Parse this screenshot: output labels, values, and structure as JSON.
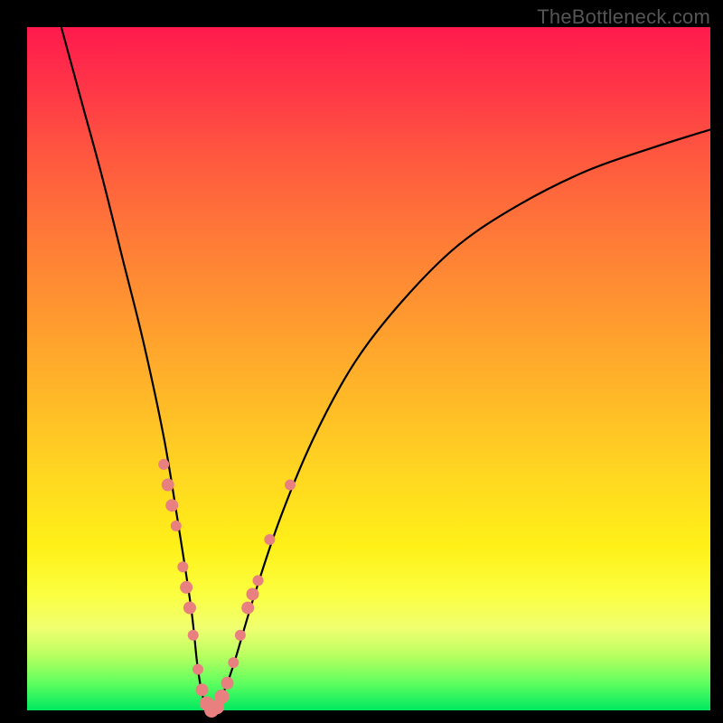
{
  "watermark": "TheBottleneck.com",
  "chart_data": {
    "type": "line",
    "title": "",
    "xlabel": "",
    "ylabel": "",
    "xlim": [
      0,
      100
    ],
    "ylim": [
      0,
      100
    ],
    "series": [
      {
        "name": "bottleneck-curve",
        "x": [
          5,
          8,
          11,
          14,
          17,
          20,
          22,
          24,
          25,
          26,
          27,
          28,
          30,
          33,
          37,
          42,
          48,
          55,
          63,
          72,
          82,
          92,
          100
        ],
        "y": [
          100,
          89,
          78,
          66,
          54,
          40,
          28,
          15,
          6,
          1,
          0,
          1,
          6,
          16,
          28,
          40,
          51,
          60,
          68,
          74,
          79,
          82.5,
          85
        ]
      }
    ],
    "markers": [
      {
        "x": 20.0,
        "y": 36,
        "r": 6
      },
      {
        "x": 20.6,
        "y": 33,
        "r": 7
      },
      {
        "x": 21.2,
        "y": 30,
        "r": 7
      },
      {
        "x": 21.8,
        "y": 27,
        "r": 6
      },
      {
        "x": 22.8,
        "y": 21,
        "r": 6
      },
      {
        "x": 23.3,
        "y": 18,
        "r": 7
      },
      {
        "x": 23.8,
        "y": 15,
        "r": 7
      },
      {
        "x": 24.3,
        "y": 11,
        "r": 6
      },
      {
        "x": 25.0,
        "y": 6,
        "r": 6
      },
      {
        "x": 25.6,
        "y": 3,
        "r": 7
      },
      {
        "x": 26.3,
        "y": 1,
        "r": 8
      },
      {
        "x": 27.0,
        "y": 0,
        "r": 8
      },
      {
        "x": 27.8,
        "y": 0.5,
        "r": 8
      },
      {
        "x": 28.5,
        "y": 2,
        "r": 8
      },
      {
        "x": 29.3,
        "y": 4,
        "r": 7
      },
      {
        "x": 30.2,
        "y": 7,
        "r": 6
      },
      {
        "x": 31.2,
        "y": 11,
        "r": 6
      },
      {
        "x": 32.3,
        "y": 15,
        "r": 7
      },
      {
        "x": 33.0,
        "y": 17,
        "r": 7
      },
      {
        "x": 33.8,
        "y": 19,
        "r": 6
      },
      {
        "x": 35.5,
        "y": 25,
        "r": 6
      },
      {
        "x": 38.5,
        "y": 33,
        "r": 6
      }
    ],
    "marker_color": "#e8807f",
    "curve_color": "#000000"
  }
}
